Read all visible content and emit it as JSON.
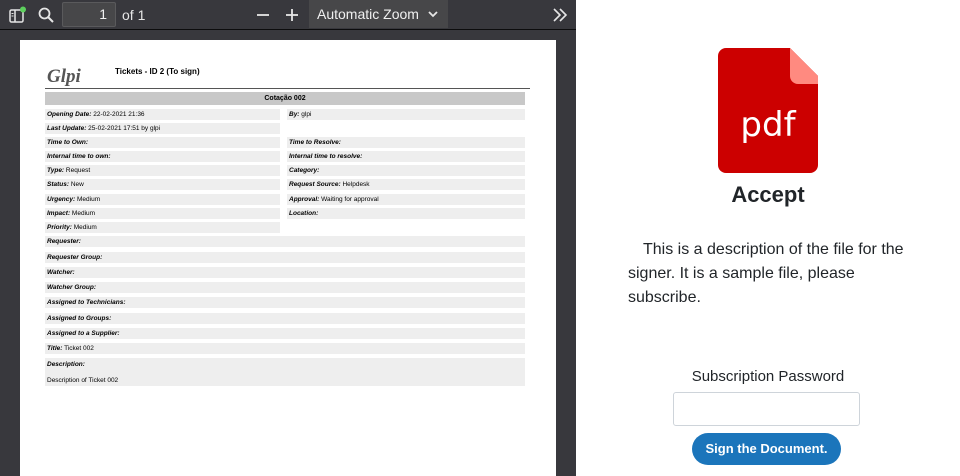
{
  "toolbar": {
    "page_number": "1",
    "page_count": "of 1",
    "zoom": "Automatic Zoom",
    "sidebar_badge_color": "#5dd05d"
  },
  "document": {
    "logo": "Glpi",
    "title": "Tickets - ID 2  (To sign)",
    "section": "Cotação 002",
    "left_rows": [
      {
        "label": "Opening Date",
        "value": "22-02-2021 21:36"
      },
      {
        "label": "Last Update",
        "value": "25-02-2021 17:51 by glpi"
      },
      {
        "label": "Time to Own",
        "value": ""
      },
      {
        "label": "Internal time to own",
        "value": ""
      },
      {
        "label": "Type",
        "value": "Request"
      },
      {
        "label": "Status",
        "value": "New"
      },
      {
        "label": "Urgency",
        "value": "Medium"
      },
      {
        "label": "Impact",
        "value": "Medium"
      },
      {
        "label": "Priority",
        "value": "Medium"
      }
    ],
    "right_rows": [
      {
        "label": "By",
        "value": "glpi"
      },
      {
        "label": "Time to Resolve",
        "value": ""
      },
      {
        "label": "Internal time to resolve",
        "value": ""
      },
      {
        "label": "Category",
        "value": ""
      },
      {
        "label": "Request Source",
        "value": "Helpdesk"
      },
      {
        "label": "Approval",
        "value": "Waiting for approval"
      },
      {
        "label": "Location",
        "value": ""
      }
    ],
    "full_rows": [
      {
        "label": "Requester",
        "value": ""
      },
      {
        "label": "Requester Group",
        "value": ""
      },
      {
        "label": "Watcher",
        "value": ""
      },
      {
        "label": "Watcher Group",
        "value": ""
      },
      {
        "label": "Assigned to Technicians",
        "value": ""
      },
      {
        "label": "Assigned to Groups",
        "value": ""
      },
      {
        "label": "Assigned to a Supplier",
        "value": ""
      },
      {
        "label": "Title",
        "value": "Ticket 002"
      }
    ],
    "description_label": "Description:",
    "description_value": "Description of Ticket 002"
  },
  "panel": {
    "file_icon_text": "pdf",
    "file_icon_color": "#cc0000",
    "file_icon_fold_color": "#ff8a80",
    "heading": "Accept",
    "description": "This is a description of the file for the signer. It is a sample file, please subscribe.",
    "password_label": "Subscription Password",
    "password_value": "",
    "sign_button": "Sign the Document.",
    "button_color": "#1b75bb"
  }
}
